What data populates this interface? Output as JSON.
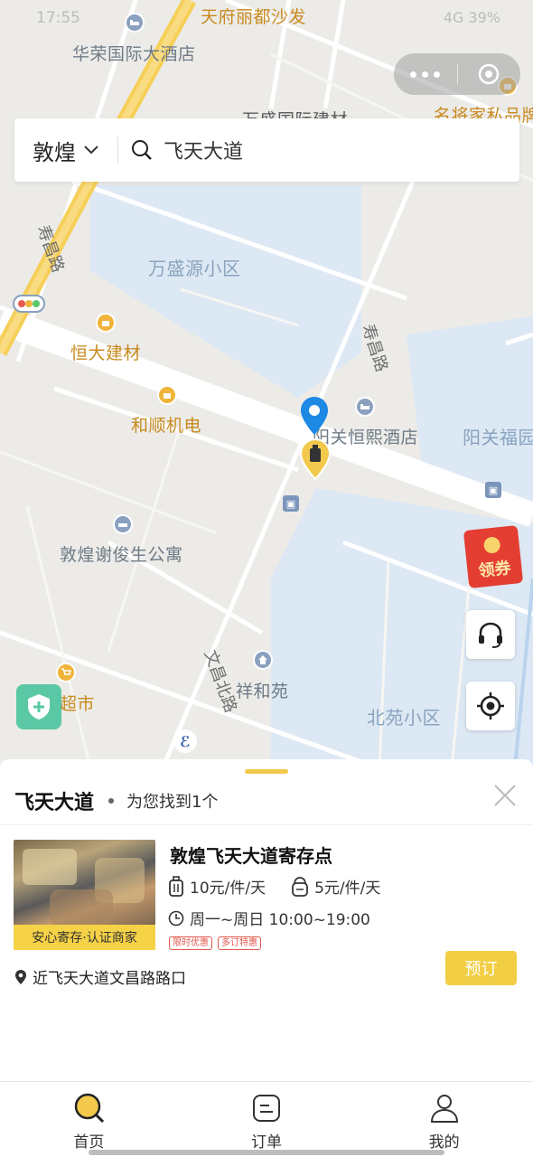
{
  "status_bar": {
    "time": "17:55",
    "right": "4G 39%"
  },
  "capsule": {
    "more_icon": "more-dots-icon",
    "close_icon": "target-circle-icon"
  },
  "search": {
    "city": "敦煌",
    "query": "飞天大道"
  },
  "map": {
    "pois": {
      "tianfu": "天府丽都沙发",
      "huarong": "华荣国际大酒店",
      "wanshengcheng": "万盛国际建材",
      "mingjiang": "名将家私品牌",
      "wanshengyuan": "万盛源小区",
      "hengda": "恒大建材",
      "heshun": "和顺机电",
      "yangguan_hotel": "阳关恒熙酒店",
      "yangguan_fu": "阳关福园",
      "xie_apartment": "敦煌谢俊生公寓",
      "supermarket": "超市",
      "xiangheyuan": "祥和苑",
      "beiyuan": "北苑小区"
    },
    "roads": {
      "shouchang_1": "寿昌路",
      "shouchang_2": "寿昌路",
      "wenchang": "文昌北路"
    },
    "coupon_label": "领券"
  },
  "panel": {
    "title": "飞天大道",
    "subtitle": "为您找到1个",
    "result": {
      "name": "敦煌飞天大道寄存点",
      "price_luggage": "10元/件/天",
      "price_bag": "5元/件/天",
      "hours": "周一~周日 10:00~19:00",
      "tags": [
        "限时优惠",
        "多订特惠"
      ],
      "image_banner": "安心寄存·认证商家",
      "address": "近飞天大道文昌路路口",
      "book_label": "预订"
    }
  },
  "tabbar": {
    "home": "首页",
    "orders": "订单",
    "mine": "我的",
    "active_color": "#f2c94c"
  },
  "colors": {
    "accent": "#f2ce45",
    "pin_blue": "#1e88e5",
    "coupon_red": "#e43e32",
    "shield_green": "#5ac8a4"
  }
}
